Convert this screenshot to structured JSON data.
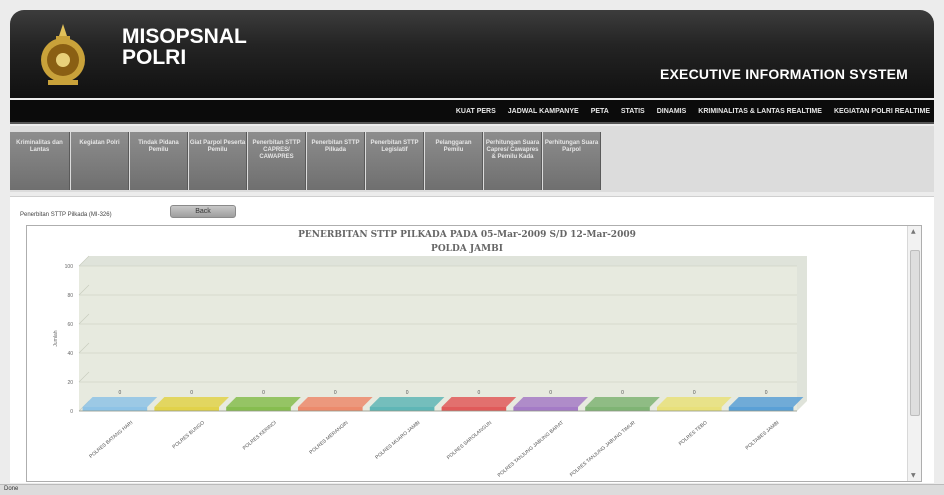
{
  "header": {
    "title_line1": "MISOPSNAL",
    "title_line2": "POLRI",
    "system_title": "EXECUTIVE INFORMATION SYSTEM"
  },
  "top_nav": [
    "KUAT PERS",
    "JADWAL KAMPANYE",
    "PETA",
    "STATIS",
    "DINAMIS",
    "KRIMINALITAS & LANTAS REALTIME",
    "KEGIATAN POLRI REALTIME"
  ],
  "tabs": [
    "Kriminalitas dan Lantas",
    "Kegiatan Polri",
    "Tindak Pidana Pemilu",
    "Giat Parpol Peserta Pemilu",
    "Penerbitan STTP CAPRES/ CAWAPRES",
    "Penerbitan STTP Pilkada",
    "Penerbitan STTP Legislatif",
    "Pelanggaran Pemilu",
    "Perhitungan Suara Capres/ Cawapres & Pemilu Kada",
    "Perhitungan Suara Parpol"
  ],
  "content": {
    "page_label": "Penerbitan STTP Pilkada (MI-326)",
    "back_label": "Back"
  },
  "status_text": "Done",
  "colors": {
    "bars": [
      "#8ec3e6",
      "#e1d24a",
      "#86bd4f",
      "#ec8a6c",
      "#5fb6b6",
      "#e05a5a",
      "#a47bc6",
      "#7fb474",
      "#e8e07a",
      "#5aa0d6"
    ]
  },
  "chart_data": {
    "type": "bar",
    "title": "PENERBITAN STTP PILKADA PADA 05-Mar-2009 S/D 12-Mar-2009",
    "subtitle": "POLDA JAMBI",
    "ylabel": "Jumlah",
    "ylim": [
      0,
      100
    ],
    "yticks": [
      "100",
      "80",
      "60",
      "40",
      "20",
      "0"
    ],
    "categories": [
      "POLRES BATANG HARI",
      "POLRES BUNGO",
      "POLRES KERINCI",
      "POLRES MERANGIN",
      "POLRES MUARO JAMBI",
      "POLRES SAROLANGUN",
      "POLRES TANJUNG JABUNG BARAT",
      "POLRES TANJUNG JABUNG TIMUR",
      "POLRES TEBO",
      "POLTABES JAMBI"
    ],
    "values": [
      0,
      0,
      0,
      0,
      0,
      0,
      0,
      0,
      0,
      0
    ]
  }
}
